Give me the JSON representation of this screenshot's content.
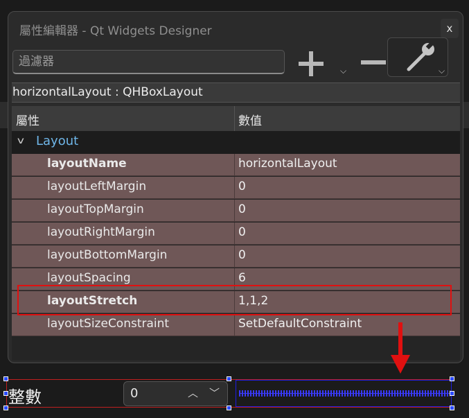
{
  "window": {
    "title": "屬性編輯器 - Qt Widgets Designer",
    "close_label": "x"
  },
  "filter": {
    "placeholder": "過濾器",
    "value": ""
  },
  "toolbar": {
    "add_icon": "plus-icon",
    "remove_icon": "minus-icon",
    "config_icon": "wrench-icon"
  },
  "object_bar": {
    "text": "horizontalLayout : QHBoxLayout"
  },
  "table": {
    "headers": {
      "property": "屬性",
      "value": "數值"
    },
    "group": {
      "label": "Layout",
      "expanded": true
    },
    "rows": [
      {
        "name": "layoutName",
        "value": "horizontalLayout",
        "modified": true
      },
      {
        "name": "layoutLeftMargin",
        "value": "0",
        "modified": false
      },
      {
        "name": "layoutTopMargin",
        "value": "0",
        "modified": false
      },
      {
        "name": "layoutRightMargin",
        "value": "0",
        "modified": false
      },
      {
        "name": "layoutBottomMargin",
        "value": "0",
        "modified": false
      },
      {
        "name": "layoutSpacing",
        "value": "6",
        "modified": false
      },
      {
        "name": "layoutStretch",
        "value": "1,1,2",
        "modified": true
      },
      {
        "name": "layoutSizeConstraint",
        "value": "SetDefaultConstraint",
        "modified": false
      }
    ]
  },
  "preview": {
    "label": "整數",
    "spinbox_value": "0"
  },
  "colors": {
    "accent_group": "#6fb6e8",
    "row_bg": "#6f5757",
    "annotation": "#e01010",
    "spacer": "#3a3aff"
  }
}
